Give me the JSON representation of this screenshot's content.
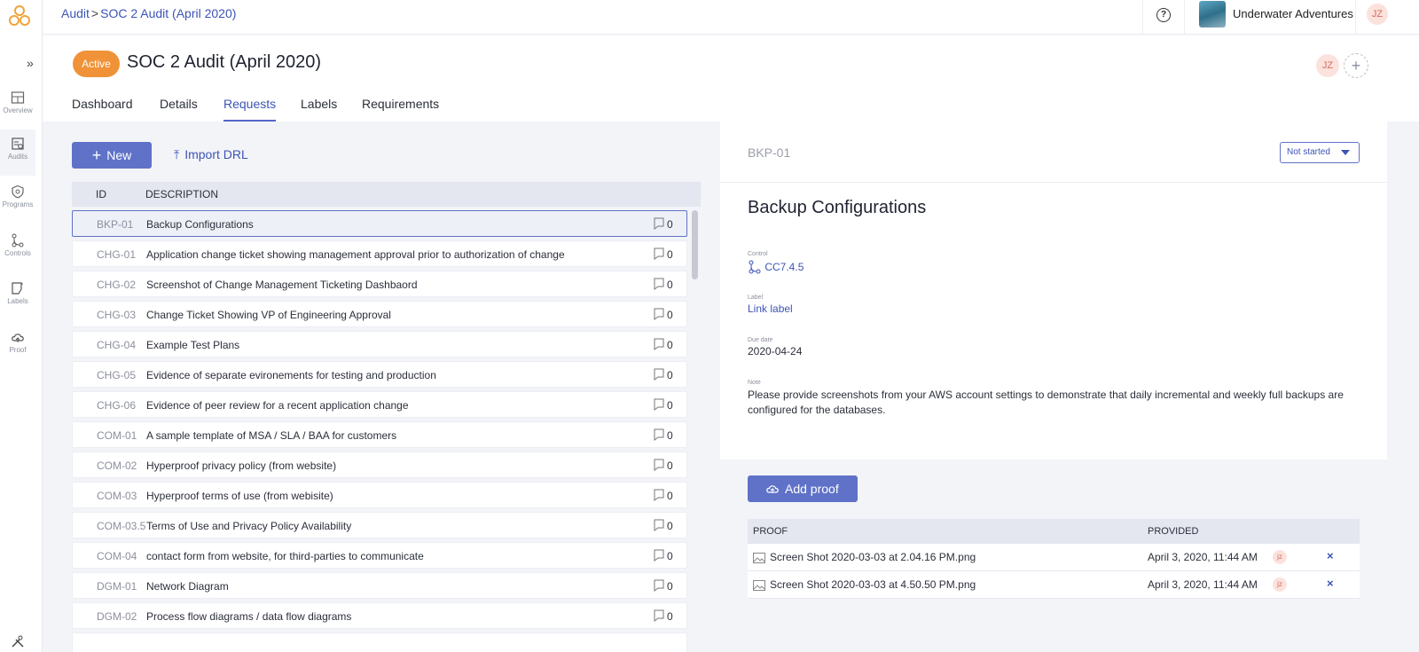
{
  "breadcrumb": {
    "root": "Audit",
    "separator": ">",
    "current": "SOC 2 Audit (April 2020)"
  },
  "rail": {
    "toggle": "»",
    "items": [
      {
        "label": "Overview",
        "icon": "overview-icon"
      },
      {
        "label": "Audits",
        "icon": "audits-icon",
        "active": true
      },
      {
        "label": "Programs",
        "icon": "programs-icon"
      },
      {
        "label": "Controls",
        "icon": "controls-icon"
      },
      {
        "label": "Labels",
        "icon": "labels-icon"
      },
      {
        "label": "Proof",
        "icon": "proof-icon"
      }
    ]
  },
  "topbar": {
    "help": "?",
    "org_name": "Underwater Adventures",
    "user_initials": "JZ"
  },
  "header": {
    "status": "Active",
    "title": "SOC 2 Audit (April 2020)",
    "member_initials": "JZ",
    "add_member": "+",
    "tabs": [
      "Dashboard",
      "Details",
      "Requests",
      "Labels",
      "Requirements"
    ],
    "active_tab": "Requests"
  },
  "toolbar": {
    "new_label": "New",
    "new_icon": "+",
    "import_label": "Import DRL",
    "import_icon": "⤒"
  },
  "table": {
    "columns": {
      "id": "ID",
      "description": "DESCRIPTION"
    },
    "rows": [
      {
        "id": "BKP-01",
        "description": "Backup Configurations",
        "count": "0",
        "selected": true
      },
      {
        "id": "CHG-01",
        "description": "Application change ticket showing management approval prior to authorization of change",
        "count": "0"
      },
      {
        "id": "CHG-02",
        "description": "Screenshot of Change Management Ticketing Dashbaord",
        "count": "0"
      },
      {
        "id": "CHG-03",
        "description": "Change Ticket Showing VP of Engineering Approval",
        "count": "0"
      },
      {
        "id": "CHG-04",
        "description": "Example Test Plans",
        "count": "0"
      },
      {
        "id": "CHG-05",
        "description": "Evidence of separate evironements for testing and production",
        "count": "0"
      },
      {
        "id": "CHG-06",
        "description": "Evidence of peer review for a recent application change",
        "count": "0"
      },
      {
        "id": "COM-01",
        "description": "A sample template of MSA / SLA / BAA for customers",
        "count": "0"
      },
      {
        "id": "COM-02",
        "description": "Hyperproof privacy policy (from website)",
        "count": "0"
      },
      {
        "id": "COM-03",
        "description": "Hyperproof terms of use (from webisite)",
        "count": "0"
      },
      {
        "id": "COM-03.5",
        "description": "Terms of Use and Privacy Policy Availability",
        "count": "0"
      },
      {
        "id": "COM-04",
        "description": "contact form from website, for third-parties to communicate",
        "count": "0"
      },
      {
        "id": "DGM-01",
        "description": "Network Diagram",
        "count": "0"
      },
      {
        "id": "DGM-02",
        "description": "Process flow diagrams / data flow diagrams",
        "count": "0"
      }
    ]
  },
  "detail": {
    "id": "BKP-01",
    "status": "Not started",
    "title": "Backup Configurations",
    "control_label": "Control",
    "control_value": "CC7.4.5",
    "label_label": "Label",
    "label_value": "Link label",
    "due_label": "Due date",
    "due_value": "2020-04-24",
    "note_label": "Note",
    "note_value": "Please provide screenshots from your AWS account settings to demonstrate that daily incremental and weekly full backups are configured for the databases.",
    "add_proof": "Add proof",
    "proof_columns": {
      "proof": "PROOF",
      "provided": "PROVIDED"
    },
    "proofs": [
      {
        "name": "Screen Shot 2020-03-03 at 2.04.16 PM.png",
        "provided": "April 3, 2020, 11:44 AM",
        "user": "jz",
        "remove": "×"
      },
      {
        "name": "Screen Shot 2020-03-03 at 4.50.50 PM.png",
        "provided": "April 3, 2020, 11:44 AM",
        "user": "jz",
        "remove": "×"
      }
    ]
  },
  "colors": {
    "accent": "#5f72c8",
    "link": "#3d54b5",
    "active_pill": "#f09237",
    "avatar_bg": "#fbe2dd"
  }
}
